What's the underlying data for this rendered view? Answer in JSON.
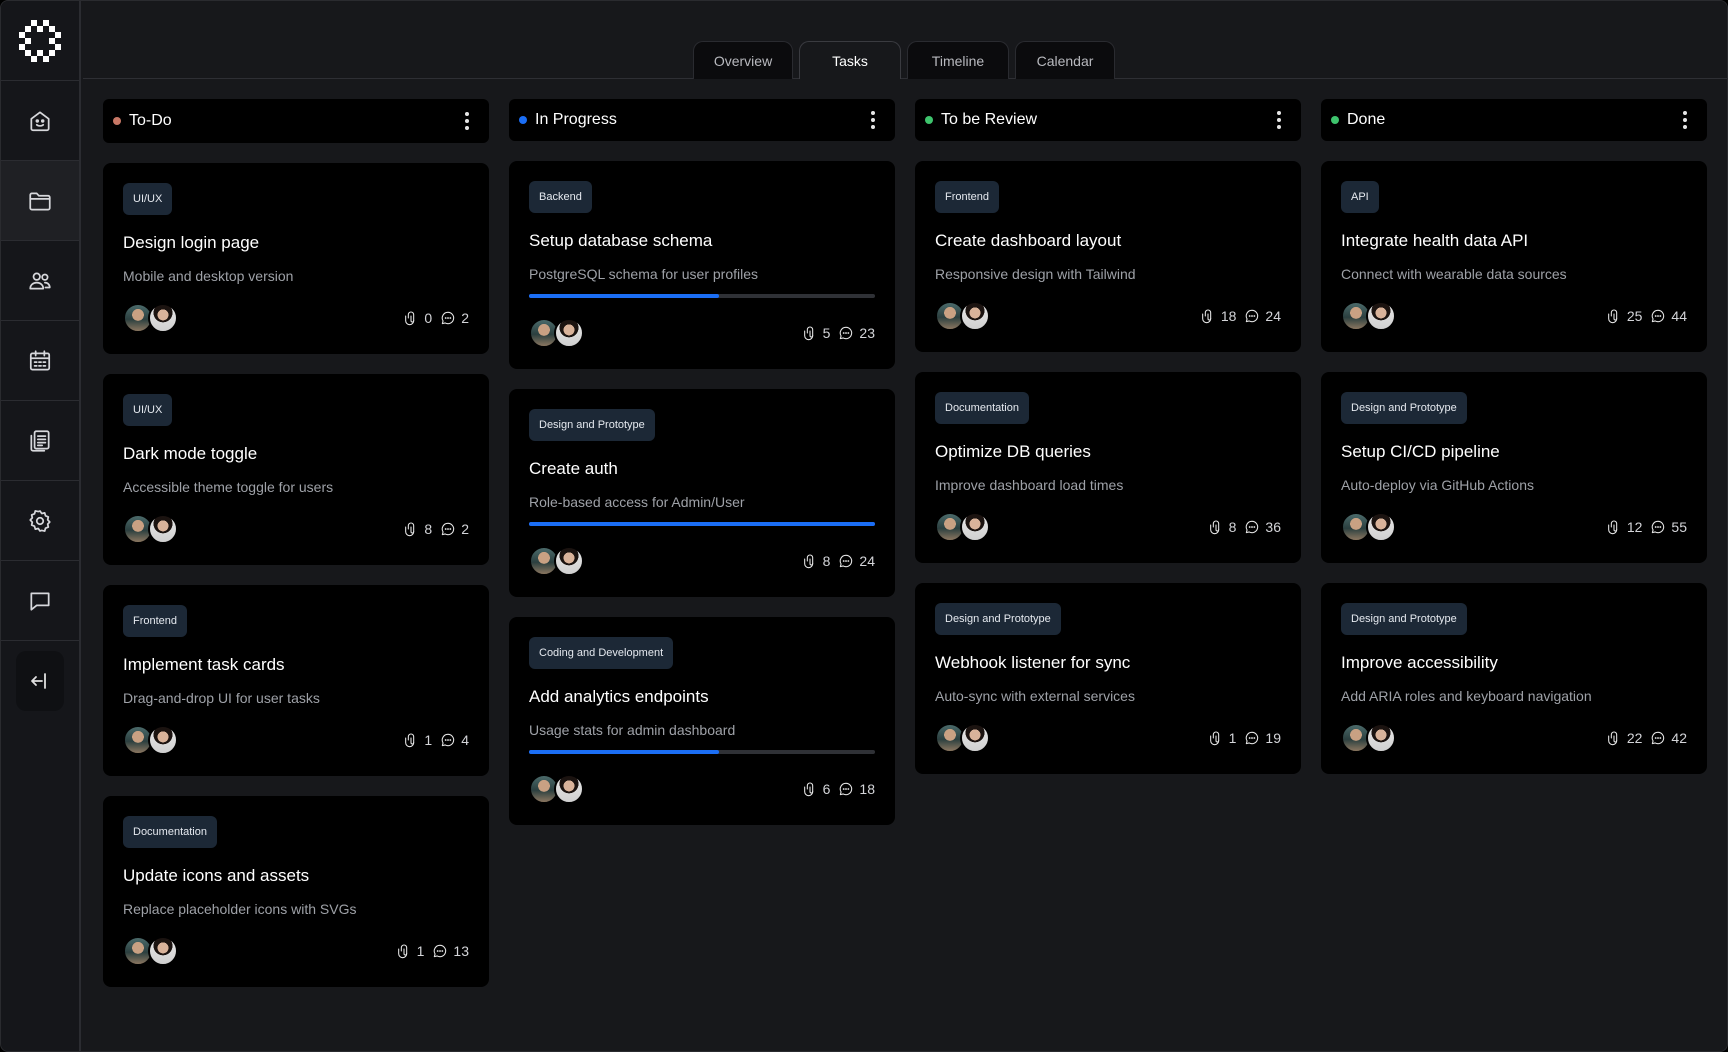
{
  "tabs": [
    {
      "label": "Overview",
      "active": false
    },
    {
      "label": "Tasks",
      "active": true
    },
    {
      "label": "Timeline",
      "active": false
    },
    {
      "label": "Calendar",
      "active": false
    }
  ],
  "sidebar": {
    "items": [
      {
        "icon": "home-icon"
      },
      {
        "icon": "folder-icon",
        "active": true
      },
      {
        "icon": "users-icon"
      },
      {
        "icon": "calendar-icon"
      },
      {
        "icon": "documents-icon"
      },
      {
        "icon": "settings-icon"
      },
      {
        "icon": "chat-icon"
      }
    ],
    "collapse_icon": "collapse-sidebar-icon"
  },
  "colors": {
    "todo": "#c87866",
    "in_progress": "#1b6ef5",
    "review": "#3ec46d",
    "done": "#3ec46d",
    "progress_fill": "#1b6ef5"
  },
  "columns": [
    {
      "title": "To-Do",
      "cards": [
        {
          "tag": "UI/UX",
          "title": "Design login page",
          "desc": "Mobile and desktop version",
          "attachments": "0",
          "comments": "2"
        },
        {
          "tag": "UI/UX",
          "title": "Dark mode toggle",
          "desc": "Accessible theme toggle for users",
          "attachments": "8",
          "comments": "2"
        },
        {
          "tag": "Frontend",
          "title": "Implement task cards",
          "desc": "Drag-and-drop UI for user tasks",
          "attachments": "1",
          "comments": "4"
        },
        {
          "tag": "Documentation",
          "title": "Update icons and assets",
          "desc": "Replace placeholder icons with SVGs",
          "attachments": "1",
          "comments": "13"
        }
      ]
    },
    {
      "title": "In Progress",
      "cards": [
        {
          "tag": "Backend",
          "title": "Setup database schema",
          "desc": "PostgreSQL schema for user profiles",
          "progress": 0.55,
          "attachments": "5",
          "comments": "23"
        },
        {
          "tag": "Design and Prototype",
          "title": "Create auth",
          "desc": "Role-based access for Admin/User",
          "progress": 1.0,
          "attachments": "8",
          "comments": "24"
        },
        {
          "tag": "Coding and Development",
          "title": "Add analytics endpoints",
          "desc": "Usage stats for admin dashboard",
          "progress": 0.55,
          "attachments": "6",
          "comments": "18"
        }
      ]
    },
    {
      "title": "To be Review",
      "cards": [
        {
          "tag": "Frontend",
          "title": "Create dashboard layout",
          "desc": "Responsive design with Tailwind",
          "attachments": "18",
          "comments": "24"
        },
        {
          "tag": "Documentation",
          "title": "Optimize DB queries",
          "desc": "Improve dashboard load times",
          "attachments": "8",
          "comments": "36"
        },
        {
          "tag": "Design and Prototype",
          "title": "Webhook listener for sync",
          "desc": "Auto-sync with external services",
          "attachments": "1",
          "comments": "19"
        }
      ]
    },
    {
      "title": "Done",
      "cards": [
        {
          "tag": "API",
          "title": "Integrate health data API",
          "desc": "Connect with wearable data sources",
          "attachments": "25",
          "comments": "44"
        },
        {
          "tag": "Design and Prototype",
          "title": "Setup CI/CD pipeline",
          "desc": "Auto-deploy via GitHub Actions",
          "attachments": "12",
          "comments": "55"
        },
        {
          "tag": "Design and Prototype",
          "title": "Improve accessibility",
          "desc": "Add ARIA roles and keyboard navigation",
          "attachments": "22",
          "comments": "42"
        }
      ]
    }
  ]
}
